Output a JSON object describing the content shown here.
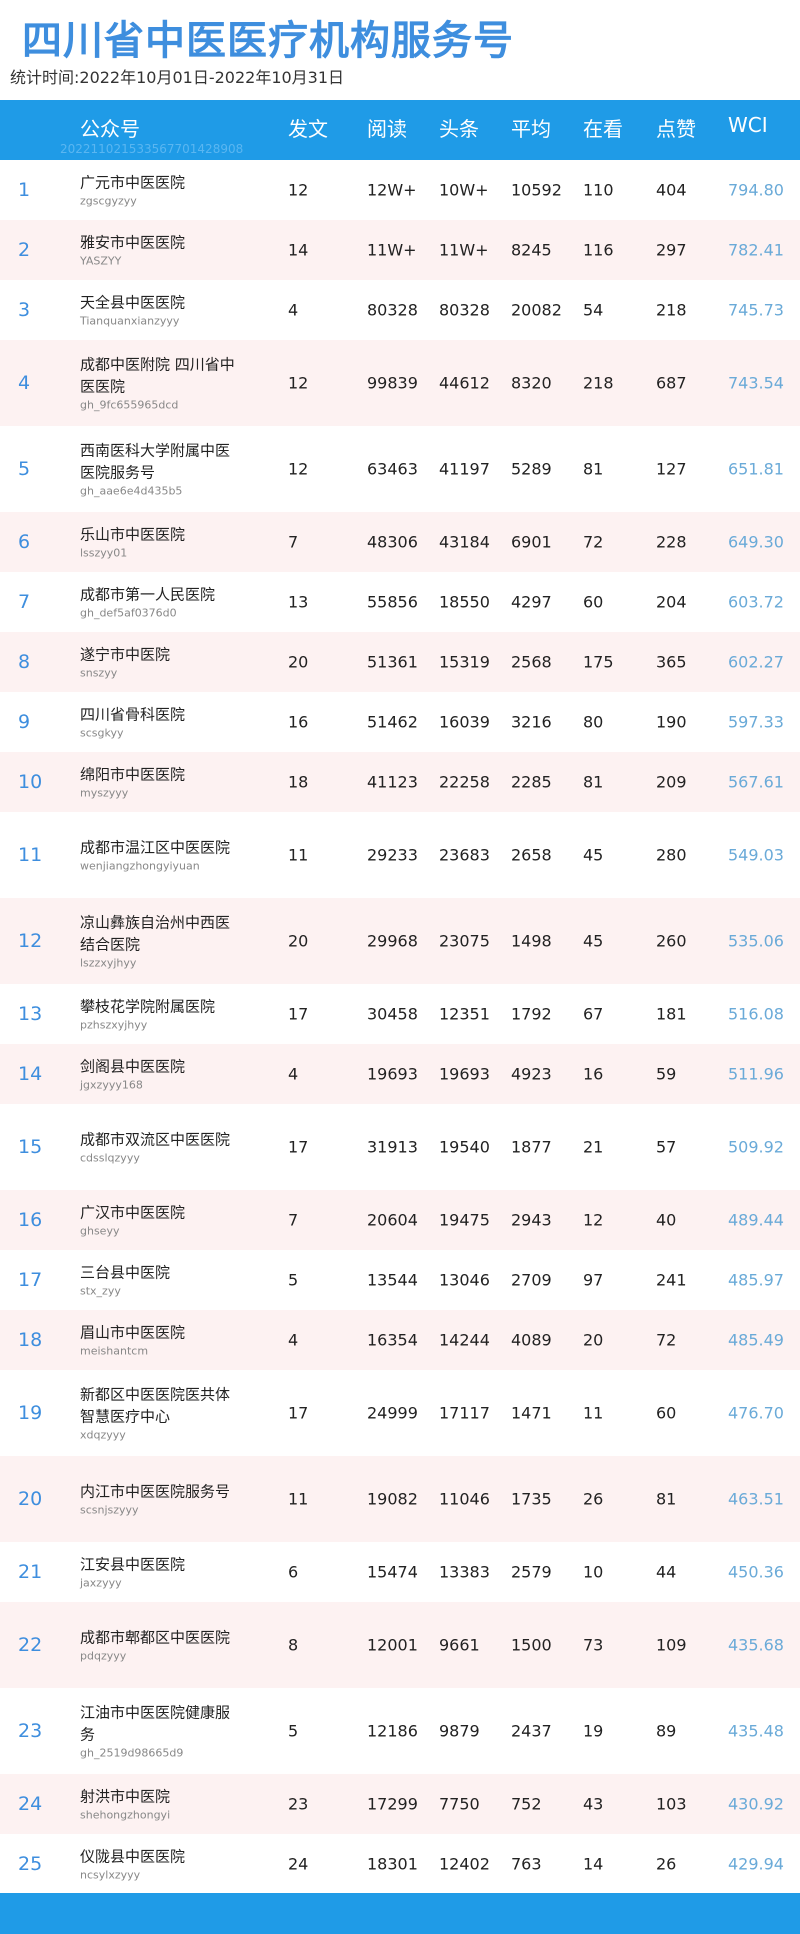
{
  "title": "四川省中医医疗机构服务号",
  "period": "统计时间:2022年10月01日-2022年10月31日",
  "columns": [
    "公众号",
    "发文",
    "阅读",
    "头条",
    "平均",
    "在看",
    "点赞",
    "WCI"
  ],
  "report_code": "20221102153356770142890​8",
  "rows": [
    {
      "rank": "1",
      "name": "广元市中医医院",
      "account": "zgscgyzyy",
      "posts": "12",
      "reads": "12W+",
      "headline": "10W+",
      "avg": "10592",
      "looks": "110",
      "likes": "404",
      "wci": "794.80"
    },
    {
      "rank": "2",
      "name": "雅安市中医医院",
      "account": "YASZYY",
      "posts": "14",
      "reads": "11W+",
      "headline": "11W+",
      "avg": "8245",
      "looks": "116",
      "likes": "297",
      "wci": "782.41"
    },
    {
      "rank": "3",
      "name": "天全县中医医院",
      "account": "Tianquanxianzyyy",
      "posts": "4",
      "reads": "80328",
      "headline": "80328",
      "avg": "20082",
      "looks": "54",
      "likes": "218",
      "wci": "745.73"
    },
    {
      "rank": "4",
      "name": "成都中医附院 四川省中医医院",
      "account": "gh_9fc655965dcd",
      "posts": "12",
      "reads": "99839",
      "headline": "44612",
      "avg": "8320",
      "looks": "218",
      "likes": "687",
      "wci": "743.54"
    },
    {
      "rank": "5",
      "name": "西南医科大学附属中医医院服务号",
      "account": "gh_aae6e4d435b5",
      "posts": "12",
      "reads": "63463",
      "headline": "41197",
      "avg": "5289",
      "looks": "81",
      "likes": "127",
      "wci": "651.81"
    },
    {
      "rank": "6",
      "name": "乐山市中医医院",
      "account": "lsszyy01",
      "posts": "7",
      "reads": "48306",
      "headline": "43184",
      "avg": "6901",
      "looks": "72",
      "likes": "228",
      "wci": "649.30"
    },
    {
      "rank": "7",
      "name": "成都市第一人民医院",
      "account": "gh_def5af0376d0",
      "posts": "13",
      "reads": "55856",
      "headline": "18550",
      "avg": "4297",
      "looks": "60",
      "likes": "204",
      "wci": "603.72"
    },
    {
      "rank": "8",
      "name": "遂宁市中医院",
      "account": "snszyy",
      "posts": "20",
      "reads": "51361",
      "headline": "15319",
      "avg": "2568",
      "looks": "175",
      "likes": "365",
      "wci": "602.27"
    },
    {
      "rank": "9",
      "name": "四川省骨科医院",
      "account": "scsgkyy",
      "posts": "16",
      "reads": "51462",
      "headline": "16039",
      "avg": "3216",
      "looks": "80",
      "likes": "190",
      "wci": "597.33"
    },
    {
      "rank": "10",
      "name": "绵阳市中医医院",
      "account": "myszyyy",
      "posts": "18",
      "reads": "41123",
      "headline": "22258",
      "avg": "2285",
      "looks": "81",
      "likes": "209",
      "wci": "567.61"
    },
    {
      "rank": "11",
      "name": "成都市温江区中医医院",
      "account": "wenjiangzhongyiyuan",
      "posts": "11",
      "reads": "29233",
      "headline": "23683",
      "avg": "2658",
      "looks": "45",
      "likes": "280",
      "wci": "549.03"
    },
    {
      "rank": "12",
      "name": "凉山彝族自治州中西医结合医院",
      "account": "lszzxyjhyy",
      "posts": "20",
      "reads": "29968",
      "headline": "23075",
      "avg": "1498",
      "looks": "45",
      "likes": "260",
      "wci": "535.06"
    },
    {
      "rank": "13",
      "name": "攀枝花学院附属医院",
      "account": "pzhszxyjhyy",
      "posts": "17",
      "reads": "30458",
      "headline": "12351",
      "avg": "1792",
      "looks": "67",
      "likes": "181",
      "wci": "516.08"
    },
    {
      "rank": "14",
      "name": "剑阁县中医医院",
      "account": "jgxzyyy168",
      "posts": "4",
      "reads": "19693",
      "headline": "19693",
      "avg": "4923",
      "looks": "16",
      "likes": "59",
      "wci": "511.96"
    },
    {
      "rank": "15",
      "name": "成都市双流区中医医院",
      "account": "cdsslqzyyy",
      "posts": "17",
      "reads": "31913",
      "headline": "19540",
      "avg": "1877",
      "looks": "21",
      "likes": "57",
      "wci": "509.92"
    },
    {
      "rank": "16",
      "name": "广汉市中医医院",
      "account": "ghseyy",
      "posts": "7",
      "reads": "20604",
      "headline": "19475",
      "avg": "2943",
      "looks": "12",
      "likes": "40",
      "wci": "489.44"
    },
    {
      "rank": "17",
      "name": "三台县中医院",
      "account": "stx_zyy",
      "posts": "5",
      "reads": "13544",
      "headline": "13046",
      "avg": "2709",
      "looks": "97",
      "likes": "241",
      "wci": "485.97"
    },
    {
      "rank": "18",
      "name": "眉山市中医医院",
      "account": "meishantcm",
      "posts": "4",
      "reads": "16354",
      "headline": "14244",
      "avg": "4089",
      "looks": "20",
      "likes": "72",
      "wci": "485.49"
    },
    {
      "rank": "19",
      "name": "新都区中医医院医共体智慧医疗中心",
      "account": "xdqzyyy",
      "posts": "17",
      "reads": "24999",
      "headline": "17117",
      "avg": "1471",
      "looks": "11",
      "likes": "60",
      "wci": "476.70"
    },
    {
      "rank": "20",
      "name": "内江市中医医院服务号",
      "account": "scsnjszyyy",
      "posts": "11",
      "reads": "19082",
      "headline": "11046",
      "avg": "1735",
      "looks": "26",
      "likes": "81",
      "wci": "463.51"
    },
    {
      "rank": "21",
      "name": "江安县中医医院",
      "account": "jaxzyyy",
      "posts": "6",
      "reads": "15474",
      "headline": "13383",
      "avg": "2579",
      "looks": "10",
      "likes": "44",
      "wci": "450.36"
    },
    {
      "rank": "22",
      "name": "成都市郫都区中医医院",
      "account": "pdqzyyy",
      "posts": "8",
      "reads": "12001",
      "headline": "9661",
      "avg": "1500",
      "looks": "73",
      "likes": "109",
      "wci": "435.68"
    },
    {
      "rank": "23",
      "name": "江油市中医医院健康服务",
      "account": "gh_2519d98665d9",
      "posts": "5",
      "reads": "12186",
      "headline": "9879",
      "avg": "2437",
      "looks": "19",
      "likes": "89",
      "wci": "435.48"
    },
    {
      "rank": "24",
      "name": "射洪市中医院",
      "account": "shehongzhongyi",
      "posts": "23",
      "reads": "17299",
      "headline": "7750",
      "avg": "752",
      "looks": "43",
      "likes": "103",
      "wci": "430.92"
    },
    {
      "rank": "25",
      "name": "仪陇县中医医院",
      "account": "ncsylxzyyy",
      "posts": "24",
      "reads": "18301",
      "headline": "12402",
      "avg": "763",
      "looks": "14",
      "likes": "26",
      "wci": "429.94"
    }
  ]
}
